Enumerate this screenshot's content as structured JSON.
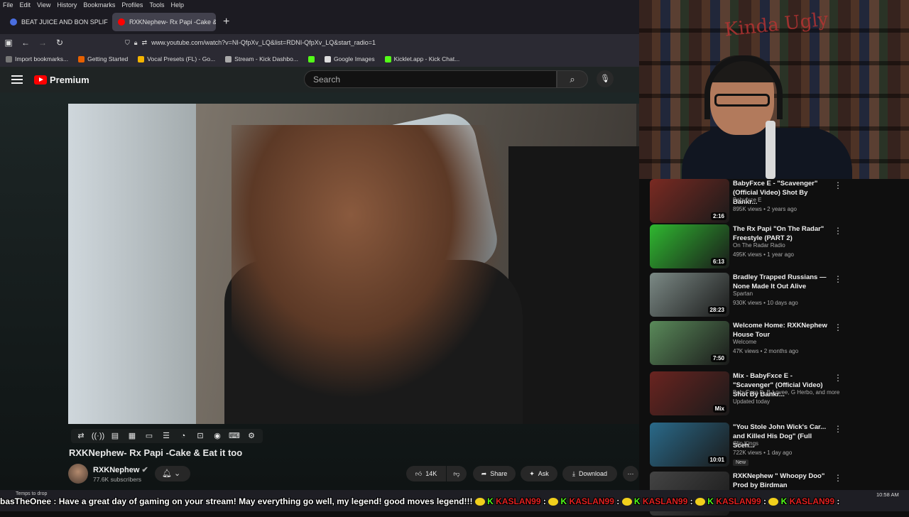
{
  "browser": {
    "menu": [
      "File",
      "Edit",
      "View",
      "History",
      "Bookmarks",
      "Profiles",
      "Tools",
      "Help"
    ],
    "tabs": [
      {
        "title": "BEAT JUICE AND BON SPLIFF - I",
        "active": false,
        "favicon_color": "#4a6ee0"
      },
      {
        "title": "RXKNephew- Rx Papi -Cake & I",
        "active": true,
        "favicon_color": "#ff0000"
      }
    ],
    "new_tab": "+",
    "url": "www.youtube.com/watch?v=NI-QfpXv_LQ&list=RDNI-QfpXv_LQ&start_radio=1",
    "bookmarks": [
      {
        "label": "Import bookmarks...",
        "color": "#777"
      },
      {
        "label": "Getting Started",
        "color": "#e66000"
      },
      {
        "label": "Vocal Presets (FL) - Go...",
        "color": "#f4b400"
      },
      {
        "label": "Stream - Kick Dashbo...",
        "color": "#aaa"
      },
      {
        "label": "",
        "color": "#53fc18"
      },
      {
        "label": "Google Images",
        "color": "#ddd"
      },
      {
        "label": "Kicklet.app - Kick Chat...",
        "color": "#53fc18"
      }
    ]
  },
  "youtube": {
    "logo_text": "Premium",
    "search_placeholder": "Search",
    "video": {
      "title": "RXKNephew- Rx Papi -Cake & Eat it too",
      "channel": "RXKNephew",
      "subscribers": "77.6K subscribers",
      "likes": "14K",
      "share": "Share",
      "ask": "Ask",
      "download": "Download"
    },
    "recommendations": [
      {
        "title": "BabyFxce E - \"Scavenger\" (Official Video) Shot By Bankr...",
        "channel": "Babyfxce E",
        "meta": "895K views • 2 years ago",
        "duration": "2:16",
        "thumb": "#7a2a22",
        "badge": ""
      },
      {
        "title": "The Rx Papi \"On The Radar\" Freestyle (PART 2)",
        "channel": "On The Radar Radio",
        "meta": "495K views • 1 year ago",
        "duration": "6:13",
        "thumb": "#2fb830",
        "badge": ""
      },
      {
        "title": "Bradley Trapped Russians — None Made It Out Alive",
        "channel": "Spartan",
        "meta": "930K views • 10 days ago",
        "duration": "28:23",
        "thumb": "#7c8a86",
        "badge": ""
      },
      {
        "title": "Welcome Home: RXKNephew House Tour",
        "channel": "Welcome",
        "meta": "47K views • 2 months ago",
        "duration": "7:50",
        "thumb": "#5a8a5a",
        "badge": ""
      },
      {
        "title": "Mix - BabyFxce E - \"Scavenger\" (Official Video) Shot By Bankr...",
        "channel": "BabyFxce E, B-Lovee, G Herbo, and more",
        "meta": "Updated today",
        "duration": "Mix",
        "thumb": "#6a2420",
        "badge": ""
      },
      {
        "title": "\"You Stole John Wick's Car... and Killed His Dog\" (Full Scen...",
        "channel": "Clip Kings",
        "meta": "722K views • 1 day ago",
        "duration": "10:01",
        "thumb": "#2a6a8a",
        "badge": "New"
      },
      {
        "title": "RXKNephew \" Whoopy Doo\" Prod by Birdman",
        "channel": "",
        "meta": "",
        "duration": "",
        "thumb": "#444",
        "badge": ""
      }
    ]
  },
  "overlay": {
    "chat_user": "basTheOnee",
    "chat_message": " : Have a great day of gaming on your stream! May everything go well, my legend! good moves legend!!!",
    "chat_spam": "KASLAN99",
    "temps_tip": "Temps to drop",
    "clock": "10:58 AM",
    "webcam_sign": "Kinda Ugly"
  }
}
